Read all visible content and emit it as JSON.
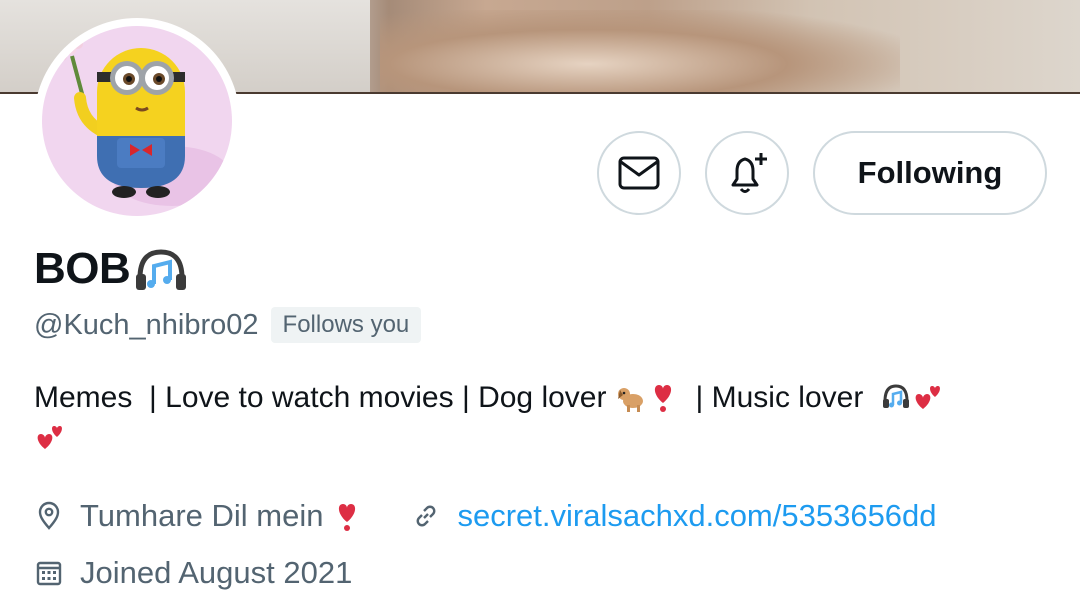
{
  "profile": {
    "display_name": "BOB",
    "handle": "@Kuch_nhibro02",
    "follows_you_badge": "Follows you",
    "bio_parts": {
      "part1": "Memes  | Love to watch movies | Dog lover ",
      "part2": "  | Music lover  "
    },
    "location": "Tumhare Dil mein",
    "website": "secret.viralsachxd.com/5353656dd",
    "joined": "Joined August 2021"
  },
  "actions": {
    "following_label": "Following"
  },
  "icons": {
    "message": "envelope-icon",
    "notify": "bell-plus-icon",
    "location": "map-pin-icon",
    "link": "link-icon",
    "calendar": "calendar-icon"
  },
  "colors": {
    "link": "#1d9bf0",
    "secondary_text": "#536471",
    "button_border": "#cfd9de",
    "heart": "#dd2e44"
  }
}
